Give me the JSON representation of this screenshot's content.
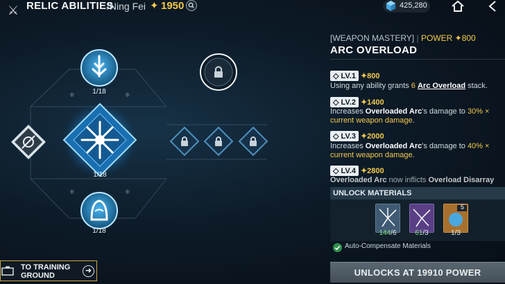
{
  "header": {
    "title": "RELIC ABILITIES",
    "subtitle": "/Ning Fei",
    "power": "1950",
    "currency": "425,280"
  },
  "tree": {
    "top_node_count": "1/18",
    "center_node_count": "1/18",
    "bottom_node_count": "1/18"
  },
  "panel": {
    "category": "[WEAPON MASTERY]",
    "power_label": "POWER",
    "power_value": "800",
    "ability_name": "ARC OVERLOAD",
    "levels": [
      {
        "label": "LV.1",
        "cost": "800",
        "desc_pre": "Using any ability grants ",
        "desc_num": "6",
        "desc_link": "Arc Overload",
        "desc_post": " stack."
      },
      {
        "label": "LV.2",
        "cost": "1400",
        "desc_pre": "Increases ",
        "desc_bold": "Overloaded Arc",
        "desc_mid": "'s damage to ",
        "desc_hl": "30% ×",
        "desc_hl2": "current weapon damage",
        "desc_post": "."
      },
      {
        "label": "LV.3",
        "cost": "2000",
        "desc_pre": "Increases ",
        "desc_bold": "Overloaded Arc",
        "desc_mid": "'s damage to ",
        "desc_hl": "40% ×",
        "desc_hl2": "current weapon damage",
        "desc_post": "."
      },
      {
        "label": "LV.4",
        "cost": "2800",
        "desc_pre": "Overloaded Arc",
        "desc_mid": " now inflicts ",
        "desc_bold": "Overload Disarray"
      }
    ],
    "materials_header": "UNLOCK MATERIALS",
    "materials": [
      {
        "count": "144",
        "need": "/6"
      },
      {
        "count": "61",
        "need": "/3"
      },
      {
        "count": "",
        "need": "1/3",
        "badge": "5"
      }
    ],
    "auto_compensate": "Auto-Compensate Materials",
    "unlock_button": "UNLOCKS AT 19910 POWER"
  },
  "footer": {
    "training_label": "TO TRAINING GROUND"
  },
  "colors": {
    "accent": "#f2c94c",
    "node_glow": "#4fb6f5",
    "panel_bg": "#14222e"
  }
}
